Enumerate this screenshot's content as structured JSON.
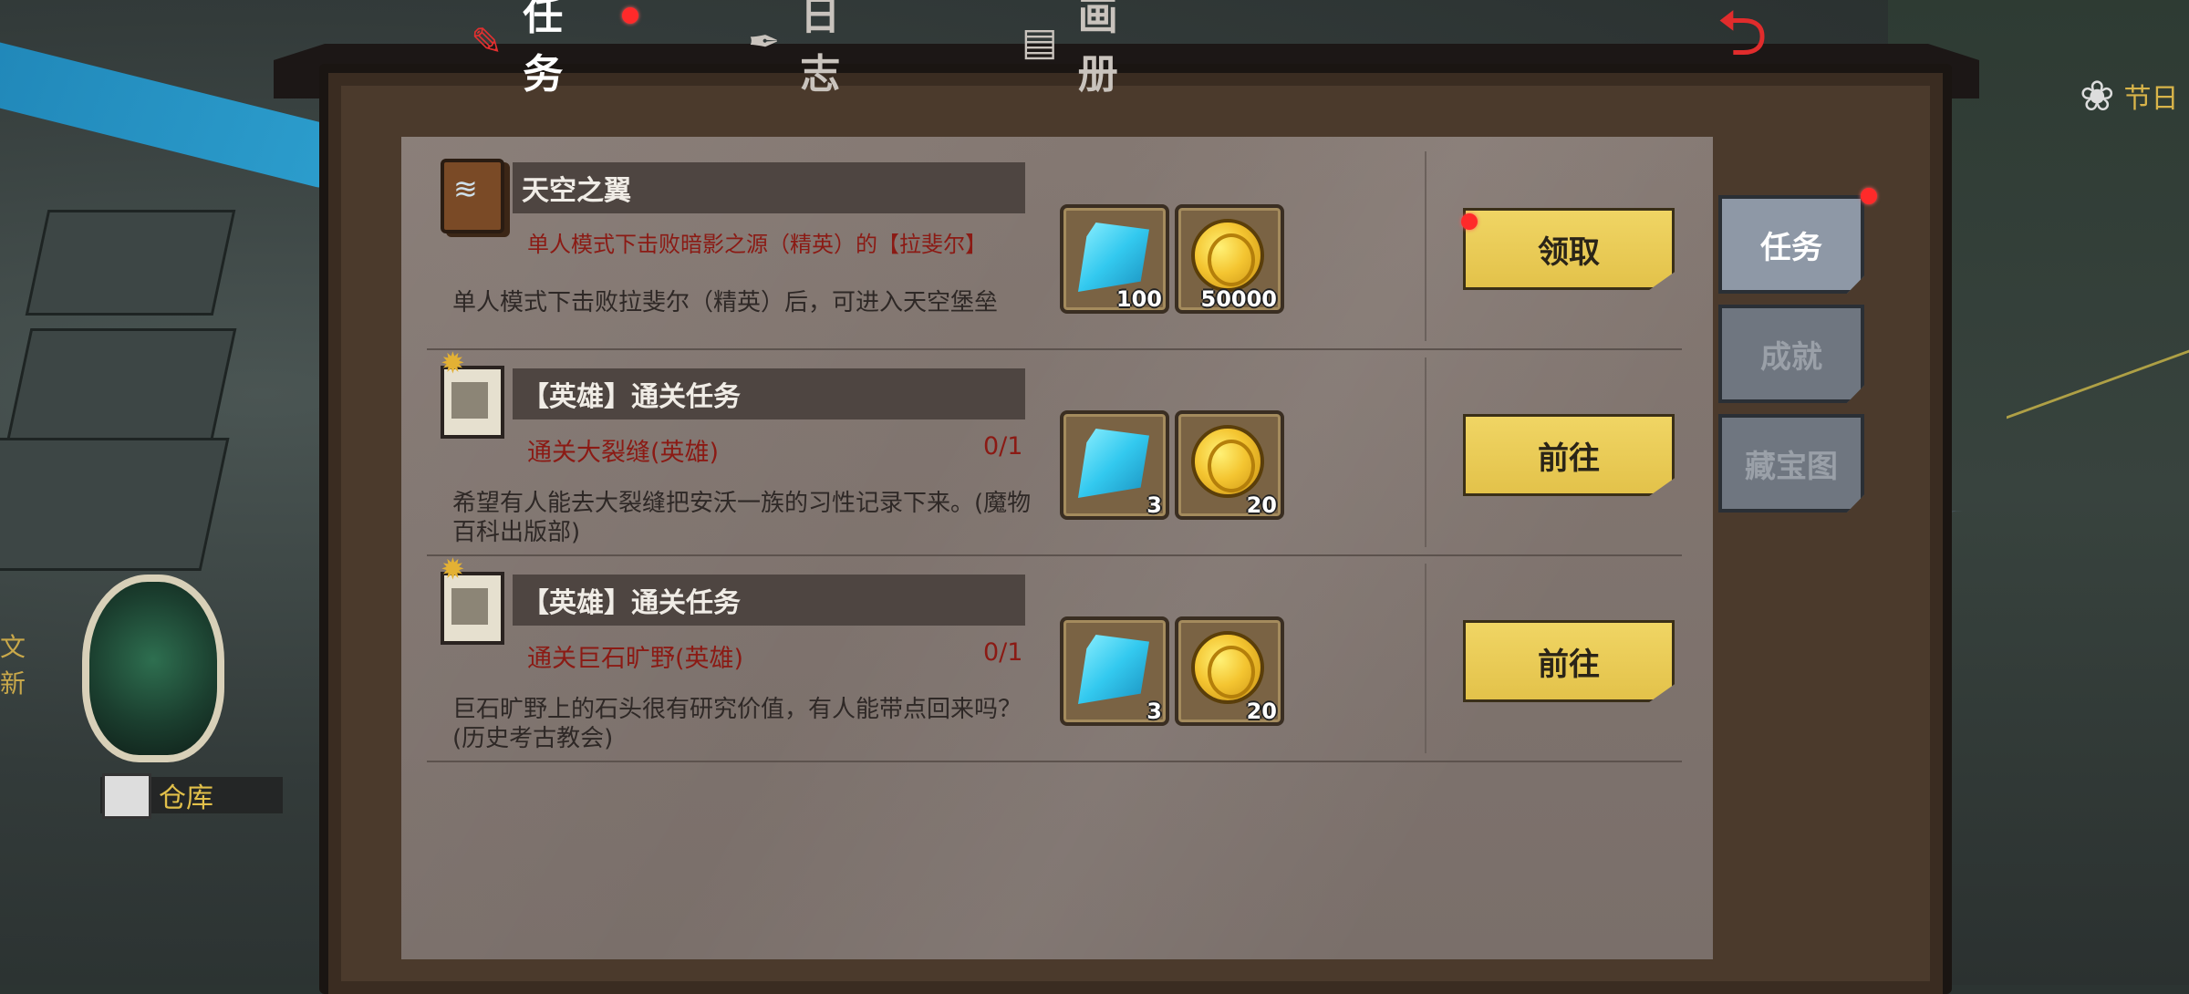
{
  "top_tabs": [
    {
      "label": "任务",
      "icon": "quest-scroll-icon",
      "active": true
    },
    {
      "label": "日志",
      "icon": "quill-icon",
      "active": false
    },
    {
      "label": "画册",
      "icon": "album-icon",
      "active": false
    }
  ],
  "back_icon": "back-arrow-icon",
  "side_tabs": [
    {
      "label": "任务",
      "active": true
    },
    {
      "label": "成就",
      "active": false
    },
    {
      "label": "藏宝图",
      "active": false
    }
  ],
  "quests": [
    {
      "icon": "spell-book-icon",
      "title": "天空之翼",
      "condition": "单人模式下击败暗影之源（精英）的【拉斐尔】",
      "progress": "",
      "description": "单人模式下击败拉斐尔（精英）后，可进入天空堡垒",
      "rewards": [
        {
          "type": "gem",
          "amount": "100"
        },
        {
          "type": "coin",
          "amount": "50000"
        }
      ],
      "action": "领取"
    },
    {
      "icon": "hero-notice-icon",
      "title": "【英雄】通关任务",
      "condition": "通关大裂缝(英雄)",
      "progress": "0/1",
      "description": "希望有人能去大裂缝把安沃一族的习性记录下来。(魔物百科出版部)",
      "rewards": [
        {
          "type": "gem",
          "amount": "3"
        },
        {
          "type": "coin",
          "amount": "20"
        }
      ],
      "action": "前往"
    },
    {
      "icon": "hero-notice-icon",
      "title": "【英雄】通关任务",
      "condition": "通关巨石旷野(英雄)",
      "progress": "0/1",
      "description": "巨石旷野上的石头很有研究价值，有人能带点回来吗？(历史考古教会)",
      "rewards": [
        {
          "type": "gem",
          "amount": "3"
        },
        {
          "type": "coin",
          "amount": "20"
        }
      ],
      "action": "前往"
    }
  ],
  "hud": {
    "storage_label": "仓库",
    "festival_label": "节日",
    "left_clip_lines": [
      "文",
      "新"
    ]
  },
  "colors": {
    "accent_red": "#d82a2a",
    "button_gold": "#e3c24a",
    "panel": "#847872",
    "condition_text": "#8b1a14"
  }
}
